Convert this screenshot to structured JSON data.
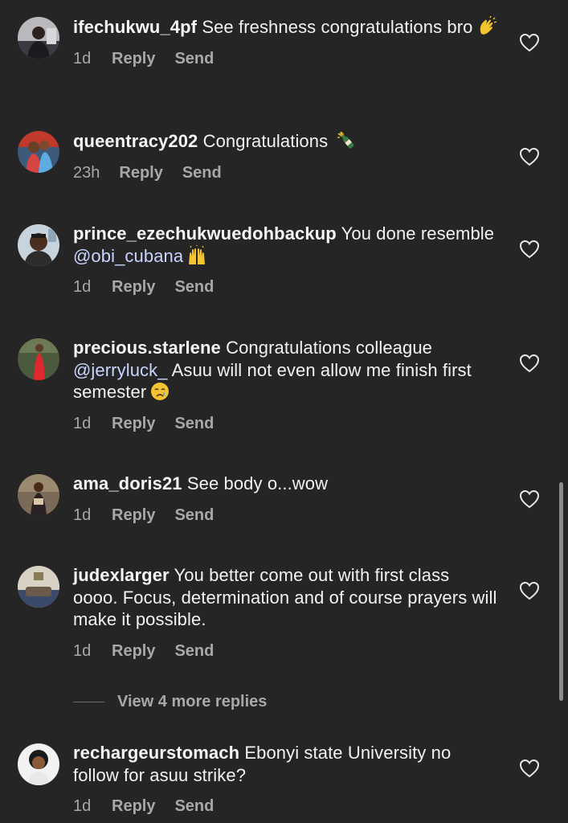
{
  "comments": [
    {
      "username": "ifechukwu_4pf",
      "text_before": "See freshness congratulations bro",
      "mention": "",
      "text_after": "",
      "emoji": "clapping-hands",
      "time": "1d",
      "reply": "Reply",
      "send": "Send"
    },
    {
      "username": "queentracy202",
      "text_before": "Congratulations",
      "mention": "",
      "text_after": "",
      "emoji": "champagne-bottle",
      "time": "23h",
      "reply": "Reply",
      "send": "Send"
    },
    {
      "username": "prince_ezechukwuedohbackup",
      "text_before": "You done resemble",
      "mention": "@obi_cubana",
      "text_after": "",
      "emoji": "raising-hands",
      "time": "1d",
      "reply": "Reply",
      "send": "Send"
    },
    {
      "username": "precious.starlene",
      "text_before": "Congratulations colleague",
      "mention": "@jerryluck_",
      "text_after": "Asuu will not even allow me finish first semester",
      "emoji": "crying-face",
      "time": "1d",
      "reply": "Reply",
      "send": "Send"
    },
    {
      "username": "ama_doris21",
      "text_before": "See body o...wow",
      "mention": "",
      "text_after": "",
      "emoji": "",
      "time": "1d",
      "reply": "Reply",
      "send": "Send"
    },
    {
      "username": "judexlarger",
      "text_before": "You better come out with first class oooo.  Focus, determination and of course prayers will make it possible.",
      "mention": "",
      "text_after": "",
      "emoji": "",
      "time": "1d",
      "reply": "Reply",
      "send": "Send"
    },
    {
      "username": "rechargeurstomach",
      "text_before": "Ebonyi state University no follow for asuu strike?",
      "mention": "",
      "text_after": "",
      "emoji": "",
      "time": "1d",
      "reply": "Reply",
      "send": "Send"
    }
  ],
  "view_more_replies": "View 4 more replies",
  "colors": {
    "background": "#252525",
    "text": "#f2f2f2",
    "muted": "#a8a8a8",
    "mention": "#c9d4ff"
  },
  "icons": {
    "like": "heart-outline-icon"
  }
}
